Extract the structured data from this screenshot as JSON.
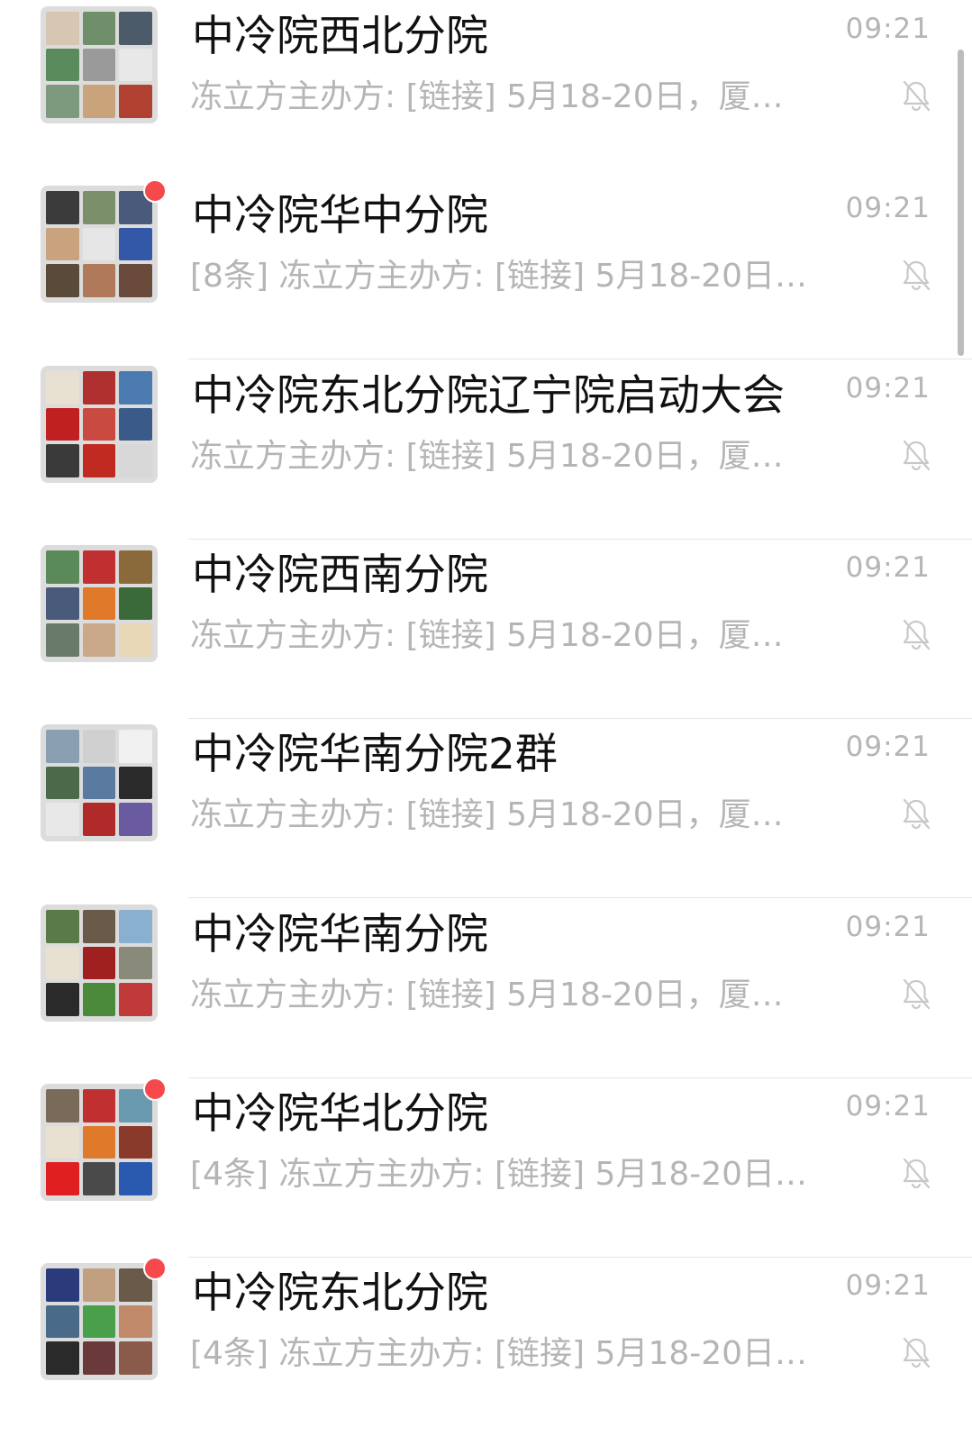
{
  "chats": [
    {
      "title": "中冷院西北分院",
      "time": "09:21",
      "preview": "冻立方主办方: [链接] 5月18-20日，厦…",
      "unread": false,
      "muted": true,
      "avatar_colors": [
        "#d7c6b2",
        "#6f8f6a",
        "#4c5b6a",
        "#5a8b5c",
        "#9a9a9a",
        "#e8e8e8",
        "#7d9a7e",
        "#c9a47a",
        "#b04030"
      ]
    },
    {
      "title": "中冷院华中分院",
      "time": "09:21",
      "preview": "[8条] 冻立方主办方: [链接] 5月18-20日…",
      "unread": true,
      "muted": true,
      "avatar_colors": [
        "#3b3b3b",
        "#7a8f6a",
        "#4a5a7a",
        "#c9a27e",
        "#e6e6e6",
        "#3358a8",
        "#5a4a3a",
        "#b07a5a",
        "#6a4a3a"
      ]
    },
    {
      "title": "中冷院东北分院辽宁院启动大会",
      "time": "09:21",
      "preview": "冻立方主办方: [链接] 5月18-20日，厦…",
      "unread": false,
      "muted": true,
      "avatar_colors": [
        "#e8e0d0",
        "#b03030",
        "#4a7ab0",
        "#c02020",
        "#c94a40",
        "#3a5a8a",
        "#3a3a3a",
        "#c02a20",
        "#d8d8d8"
      ]
    },
    {
      "title": "中冷院西南分院",
      "time": "09:21",
      "preview": "冻立方主办方: [链接] 5月18-20日，厦…",
      "unread": false,
      "muted": true,
      "avatar_colors": [
        "#5a8a5a",
        "#c03030",
        "#8a6a3a",
        "#4a5a7a",
        "#e07a2a",
        "#3a6a3a",
        "#6a7a6a",
        "#caa88a",
        "#e8d8b8"
      ]
    },
    {
      "title": "中冷院华南分院2群",
      "time": "09:21",
      "preview": "冻立方主办方: [链接] 5月18-20日，厦…",
      "unread": false,
      "muted": true,
      "avatar_colors": [
        "#8aa0b0",
        "#d0d0d0",
        "#f0f0f0",
        "#4a6a4a",
        "#5a7aa0",
        "#2a2a2a",
        "#e8e8e8",
        "#b02a2a",
        "#6a5aa0"
      ]
    },
    {
      "title": "中冷院华南分院",
      "time": "09:21",
      "preview": "冻立方主办方: [链接] 5月18-20日，厦…",
      "unread": false,
      "muted": true,
      "avatar_colors": [
        "#5a7a4a",
        "#6a5a4a",
        "#8ab0d0",
        "#e8e0d0",
        "#a02020",
        "#8a8a7a",
        "#2a2a2a",
        "#4a8a3a",
        "#c03a3a"
      ]
    },
    {
      "title": "中冷院华北分院",
      "time": "09:21",
      "preview": "[4条] 冻立方主办方: [链接] 5月18-20日…",
      "unread": true,
      "muted": true,
      "avatar_colors": [
        "#7a6a5a",
        "#c03030",
        "#6a9ab0",
        "#e8e0d0",
        "#e07a2a",
        "#8a3a2a",
        "#e02020",
        "#4a4a4a",
        "#2a5ab0"
      ]
    },
    {
      "title": "中冷院东北分院",
      "time": "09:21",
      "preview": "[4条] 冻立方主办方: [链接] 5月18-20日…",
      "unread": true,
      "muted": true,
      "avatar_colors": [
        "#2a3a7a",
        "#c0a080",
        "#6a5a4a",
        "#4a6a8a",
        "#4aa04a",
        "#c08a6a",
        "#2a2a2a",
        "#6a3a3a",
        "#8a5a4a"
      ]
    }
  ]
}
